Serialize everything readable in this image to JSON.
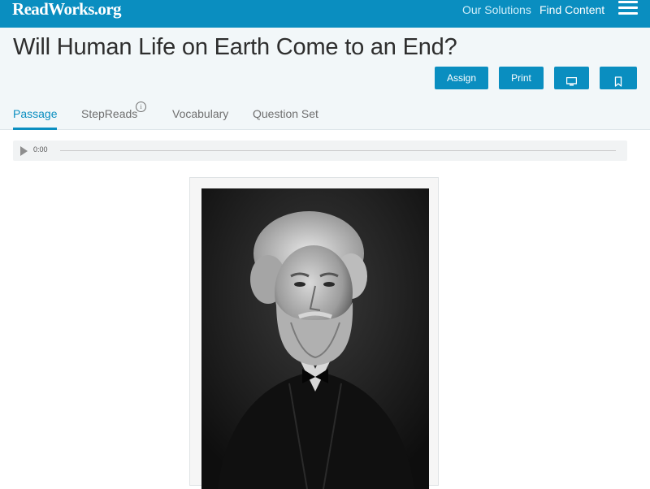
{
  "topbar": {
    "logo": "ReadWorks.org",
    "nav": [
      "Our Solutions",
      "Find Content"
    ],
    "menu_icon": "hamburger-menu-icon",
    "color": "#0a8ec0"
  },
  "article": {
    "title": "Will Human Life on Earth Come to an End?"
  },
  "actions": {
    "assign": "Assign",
    "print": "Print",
    "present_icon": "monitor-icon",
    "bookmark_icon": "bookmark-icon"
  },
  "tabs": [
    {
      "label": "Passage",
      "active": true
    },
    {
      "label": "StepReads",
      "active": false,
      "info_icon": "info-icon"
    },
    {
      "label": "Vocabulary",
      "active": false
    },
    {
      "label": "Question Set",
      "active": false
    }
  ],
  "audio": {
    "time": "0:00",
    "play_icon": "play-icon"
  },
  "colors": {
    "accent": "#0a8ec0",
    "header_bg": "#f2f7f9",
    "title_text": "#2e2e2e",
    "tab_text": "#6f6f6f"
  }
}
